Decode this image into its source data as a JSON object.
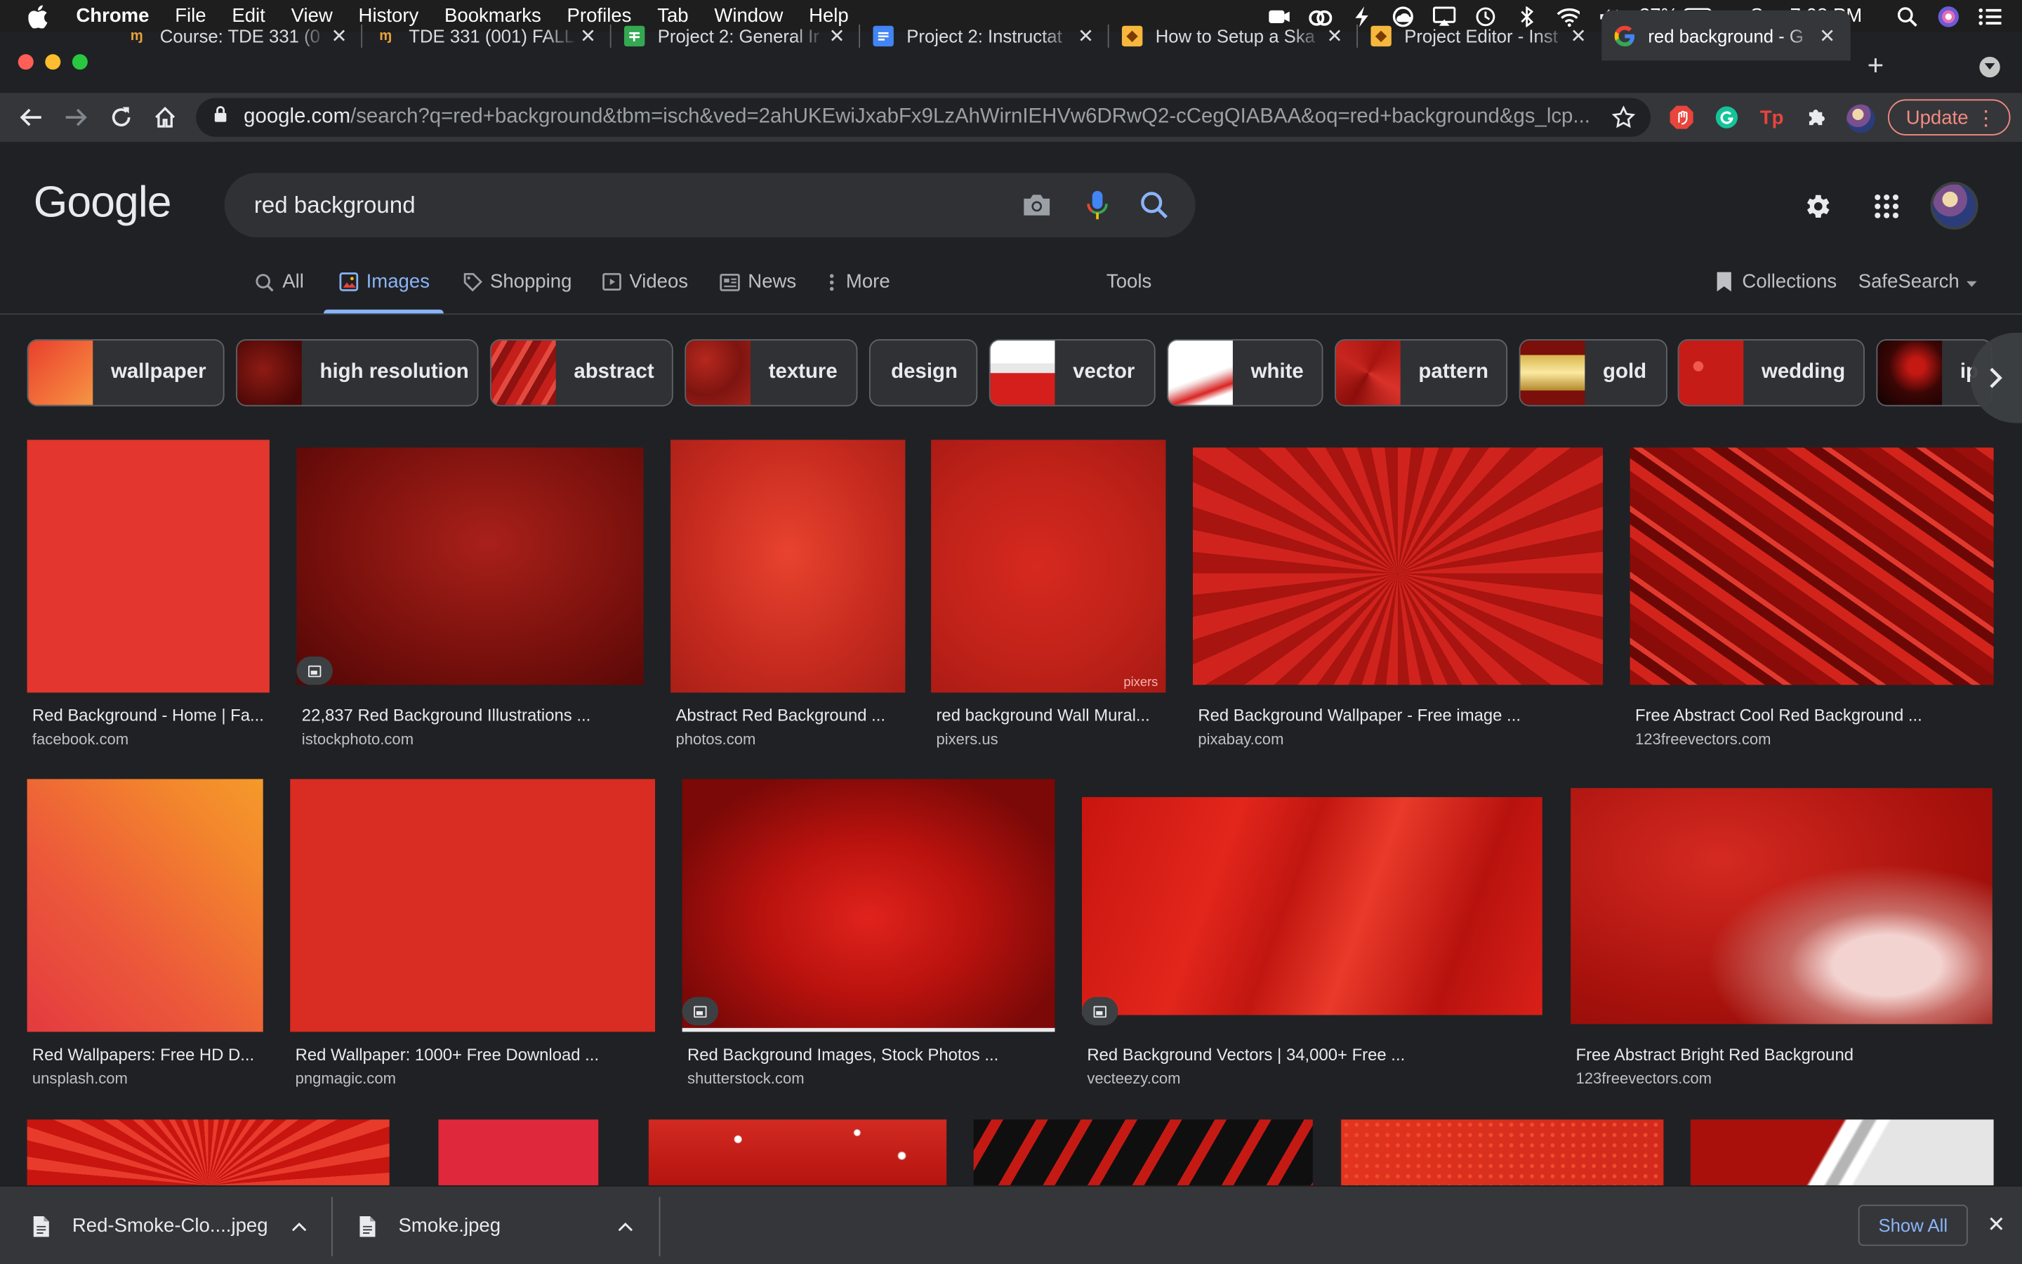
{
  "menubar": {
    "app_name": "Chrome",
    "items": [
      "File",
      "Edit",
      "View",
      "History",
      "Bookmarks",
      "Profiles",
      "Tab",
      "Window",
      "Help"
    ],
    "battery": "37%",
    "clock": "Sun 7:08 PM"
  },
  "tabs": [
    {
      "label": "Course: TDE 331 (0",
      "favicon": "instructure-icon",
      "color": "#e6a23c"
    },
    {
      "label": "TDE 331 (001) FALL",
      "favicon": "instructure-icon",
      "color": "#e6a23c"
    },
    {
      "label": "Project 2: General Ir",
      "favicon": "sheets-icon",
      "color": "#34a853"
    },
    {
      "label": "Project 2: Instructat",
      "favicon": "docs-icon",
      "color": "#4285f4"
    },
    {
      "label": "How to Setup a Ska",
      "favicon": "sketch-icon",
      "color": "#f6b73c"
    },
    {
      "label": "Project Editor - Inst",
      "favicon": "sketch-icon",
      "color": "#f6b73c"
    },
    {
      "label": "red background - G",
      "favicon": "google-icon",
      "color": "#ffffff",
      "active": true
    }
  ],
  "toolbar": {
    "url_host": "google.com",
    "url_path": "/search?q=red+background&tbm=isch&ved=2ahUKEwiJxabFx9LzAhWirnIEHVw6DRwQ2-cCegQIABAA&oq=red+background&gs_lcp...",
    "update_label": "Update"
  },
  "google": {
    "logo": "Google",
    "query": "red background"
  },
  "nav": {
    "all": "All",
    "images": "Images",
    "shopping": "Shopping",
    "videos": "Videos",
    "news": "News",
    "more": "More",
    "tools": "Tools",
    "collections": "Collections",
    "safesearch": "SafeSearch"
  },
  "chips": [
    {
      "label": "wallpaper"
    },
    {
      "label": "high resolution"
    },
    {
      "label": "abstract"
    },
    {
      "label": "texture"
    },
    {
      "label": "design"
    },
    {
      "label": "vector"
    },
    {
      "label": "white"
    },
    {
      "label": "pattern"
    },
    {
      "label": "gold"
    },
    {
      "label": "wedding"
    },
    {
      "label": "ip"
    }
  ],
  "results": [
    {
      "title": "Red Background - Home | Fa...",
      "source": "facebook.com"
    },
    {
      "title": "22,837 Red Background Illustrations ...",
      "source": "istockphoto.com"
    },
    {
      "title": "Abstract Red Background ...",
      "source": "photos.com"
    },
    {
      "title": "red background Wall Mural...",
      "source": "pixers.us",
      "watermark": "pixers"
    },
    {
      "title": "Red Background Wallpaper - Free image ...",
      "source": "pixabay.com"
    },
    {
      "title": "Free Abstract Cool Red Background ...",
      "source": "123freevectors.com"
    },
    {
      "title": "Red Wallpapers: Free HD D...",
      "source": "unsplash.com"
    },
    {
      "title": "Red Wallpaper: 1000+ Free Download ...",
      "source": "pngmagic.com"
    },
    {
      "title": "Red Background Images, Stock Photos ...",
      "source": "shutterstock.com"
    },
    {
      "title": "Red Background Vectors | 34,000+ Free ...",
      "source": "vecteezy.com"
    },
    {
      "title": "Free Abstract Bright Red Background",
      "source": "123freevectors.com"
    }
  ],
  "downloads": {
    "files": [
      "Red-Smoke-Clo....jpeg",
      "Smoke.jpeg"
    ],
    "show_all": "Show All"
  },
  "colors": {
    "accent": "#8ab4f8",
    "update": "#f28b82",
    "bg": "#202124"
  }
}
